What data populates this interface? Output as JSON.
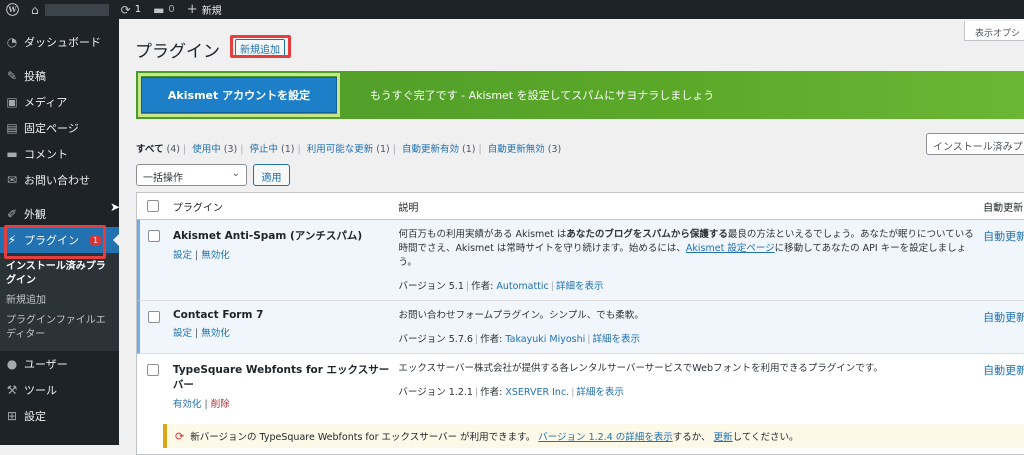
{
  "adminbar": {
    "updates_count": "1",
    "comments_count": "0",
    "new_label": "新規"
  },
  "sidebar": {
    "items": [
      {
        "label": "ダッシュボード",
        "icon": "dashboard-icon"
      },
      {
        "label": "投稿",
        "icon": "pin-icon"
      },
      {
        "label": "メディア",
        "icon": "media-icon"
      },
      {
        "label": "固定ページ",
        "icon": "page-icon"
      },
      {
        "label": "コメント",
        "icon": "comment-icon"
      },
      {
        "label": "お問い合わせ",
        "icon": "mail-icon"
      },
      {
        "label": "外観",
        "icon": "brush-icon"
      },
      {
        "label": "プラグイン",
        "icon": "plugin-icon",
        "badge": "1"
      },
      {
        "label": "ユーザー",
        "icon": "user-icon"
      },
      {
        "label": "ツール",
        "icon": "wrench-icon"
      },
      {
        "label": "設定",
        "icon": "settings-icon"
      }
    ],
    "submenu": [
      "インストール済みプラグイン",
      "新規追加",
      "プラグインファイルエディター"
    ]
  },
  "header": {
    "title": "プラグイン",
    "add_new": "新規追加",
    "screen_options": "表示オプシ"
  },
  "akismet": {
    "button": "Akismet アカウントを設定",
    "message": "もうすぐ完了です - Akismet を設定してスパムにサヨナラしましょう"
  },
  "filters": {
    "all": "すべて",
    "all_count": "(4)",
    "active": "使用中",
    "active_count": "(3)",
    "inactive": "停止中",
    "inactive_count": "(1)",
    "upgrade": "利用可能な更新",
    "upgrade_count": "(1)",
    "auto_on": "自動更新有効",
    "auto_on_count": "(1)",
    "auto_off": "自動更新無効",
    "auto_off_count": "(3)"
  },
  "search": {
    "placeholder": "インストール済みプ"
  },
  "bulk": {
    "selected": "一括操作",
    "apply": "適用"
  },
  "table": {
    "columns": {
      "name": "プラグイン",
      "desc": "説明",
      "auto": "自動更新"
    },
    "rows": [
      {
        "name": "Akismet Anti-Spam (アンチスパム)",
        "action1": "設定",
        "action2": "無効化",
        "desc_pre": "何百万もの利用実績がある Akismet は",
        "desc_bold": "あなたのブログをスパムから保護する",
        "desc_mid": "最良の方法といえるでしょう。あなたが眠りについている時間でさえ、Akismet は常時サイトを守り続けます。始めるには、",
        "desc_link": "Akismet 設定ページ",
        "desc_post": "に移動してあなたの API キーを設定しましょう。",
        "version": "バージョン 5.1",
        "author_label": "作者:",
        "author": "Automattic",
        "details": "詳細を表示",
        "auto": "自動更新を"
      },
      {
        "name": "Contact Form 7",
        "action1": "設定",
        "action2": "無効化",
        "desc": "お問い合わせフォームプラグイン。シンプル、でも柔軟。",
        "version": "バージョン 5.7.6",
        "author_label": "作者:",
        "author": "Takayuki Miyoshi",
        "details": "詳細を表示",
        "auto": "自動更新を"
      },
      {
        "name": "TypeSquare Webfonts for エックスサーバー",
        "action1": "有効化",
        "action2": "削除",
        "desc": "エックスサーバー株式会社が提供する各レンタルサーバーサービスでWebフォントを利用できるプラグインです。",
        "version": "バージョン 1.2.1",
        "author_label": "作者:",
        "author": "XSERVER Inc.",
        "details": "詳細を表示",
        "auto": "自動更新を"
      }
    ],
    "update": {
      "pre": "新バージョンの TypeSquare Webfonts for エックスサーバー が利用できます。",
      "link1": "バージョン 1.2.4 の詳細を表示",
      "mid": "するか、",
      "link2": "更新",
      "post": "してください。"
    }
  }
}
